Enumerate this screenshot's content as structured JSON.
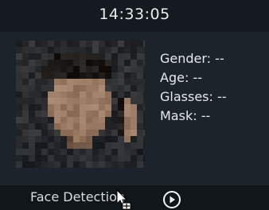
{
  "header": {
    "time": "14:33:05"
  },
  "photo": {
    "subject": "pixelated face",
    "colors": {
      "skin": "#9a7a63",
      "skin_dark": "#6e5445",
      "hair": "#1d1a18",
      "shirt": "#24282d",
      "background": "#2a2c2e"
    }
  },
  "attributes": [
    {
      "label": "Gender:",
      "value": "--"
    },
    {
      "label": "Age:",
      "value": "--"
    },
    {
      "label": "Glasses:",
      "value": "--"
    },
    {
      "label": "Mask:",
      "value": "--"
    }
  ],
  "footer": {
    "title": "Face Detection",
    "play_icon": "play-circle-icon",
    "cursor_icon": "move-cursor-icon"
  },
  "colors": {
    "screen_bg": "#1c232b",
    "header_bg": "#141a20",
    "footer_bg": "#11161b",
    "text": "#e6eaed"
  }
}
